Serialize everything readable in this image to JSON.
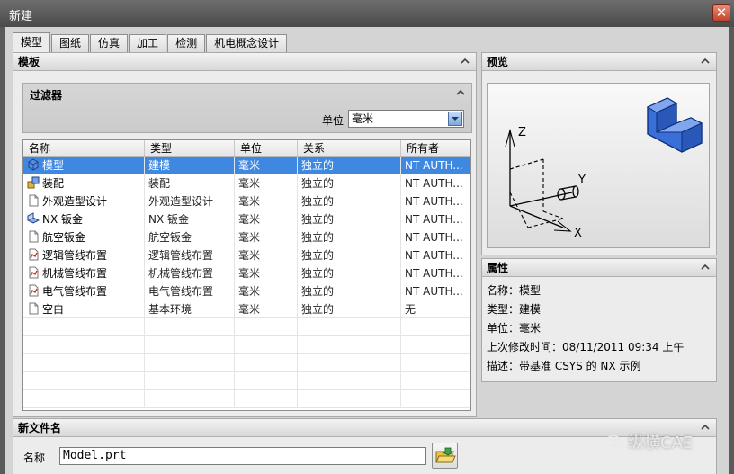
{
  "window": {
    "title": "新建",
    "close_label": "✕"
  },
  "tabs": [
    "模型",
    "图纸",
    "仿真",
    "加工",
    "检测",
    "机电概念设计"
  ],
  "templates": {
    "header": "模板",
    "filter": {
      "title": "过滤器",
      "unit_label": "单位",
      "unit_value": "毫米"
    },
    "columns": [
      "名称",
      "类型",
      "单位",
      "关系",
      "所有者"
    ],
    "rows": [
      {
        "icon": "model-icon",
        "cells": [
          "模型",
          "建模",
          "毫米",
          "独立的",
          "NT AUTH..."
        ],
        "selected": true
      },
      {
        "icon": "assembly-icon",
        "cells": [
          "装配",
          "装配",
          "毫米",
          "独立的",
          "NT AUTH..."
        ]
      },
      {
        "icon": "document-icon",
        "cells": [
          "外观造型设计",
          "外观造型设计",
          "毫米",
          "独立的",
          "NT AUTH..."
        ]
      },
      {
        "icon": "sheet-metal-icon",
        "cells": [
          "NX 钣金",
          "NX 钣金",
          "毫米",
          "独立的",
          "NT AUTH..."
        ]
      },
      {
        "icon": "document-icon",
        "cells": [
          "航空钣金",
          "航空钣金",
          "毫米",
          "独立的",
          "NT AUTH..."
        ]
      },
      {
        "icon": "routing-icon",
        "cells": [
          "逻辑管线布置",
          "逻辑管线布置",
          "毫米",
          "独立的",
          "NT AUTH..."
        ]
      },
      {
        "icon": "routing-icon",
        "cells": [
          "机械管线布置",
          "机械管线布置",
          "毫米",
          "独立的",
          "NT AUTH..."
        ]
      },
      {
        "icon": "routing-icon",
        "cells": [
          "电气管线布置",
          "电气管线布置",
          "毫米",
          "独立的",
          "NT AUTH..."
        ]
      },
      {
        "icon": "blank-icon",
        "cells": [
          "空白",
          "基本环境",
          "毫米",
          "独立的",
          "无"
        ]
      }
    ]
  },
  "preview": {
    "header": "预览",
    "axis_z": "Z",
    "axis_y": "Y",
    "axis_x": "X"
  },
  "properties": {
    "header": "属性",
    "lines": [
      "名称：模型",
      "类型：建模",
      "单位：毫米",
      "上次修改时间：08/11/2011 09:34 上午",
      "描述：带基准 CSYS 的 NX 示例"
    ]
  },
  "new_file": {
    "header": "新文件名",
    "name_label": "名称",
    "name_value": "Model.prt"
  },
  "watermark": "纵横CAE",
  "colors": {
    "selection": "#3f88e2",
    "preview_block": "#3a6fd8"
  }
}
